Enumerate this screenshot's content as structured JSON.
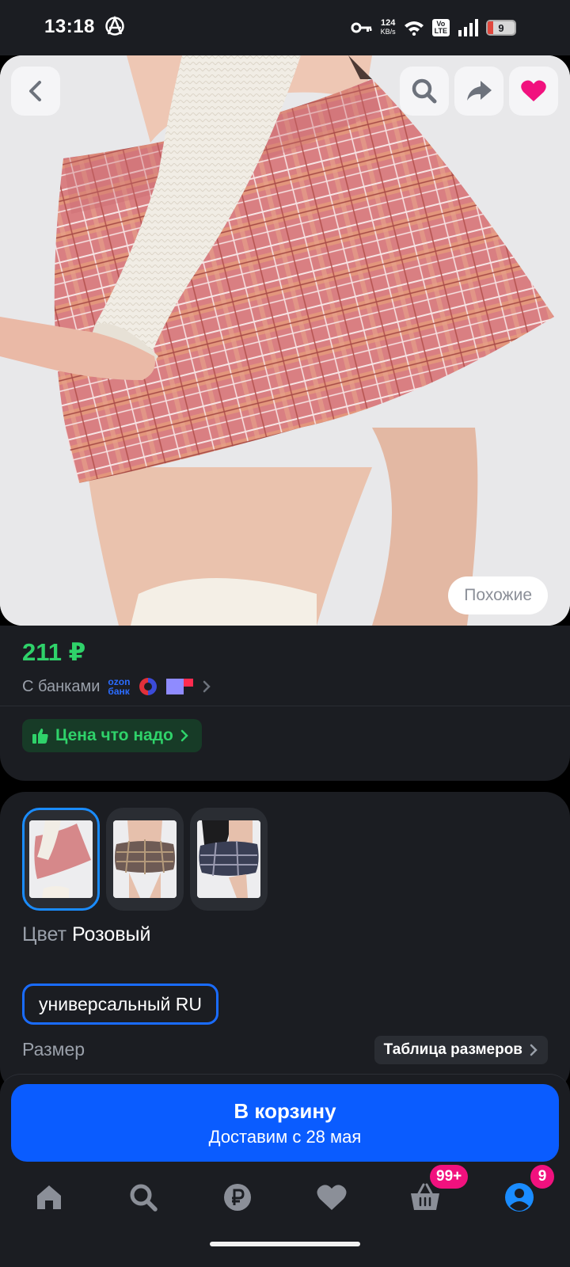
{
  "status_bar": {
    "time": "13:18",
    "net_speed_value": "124",
    "net_speed_unit": "KB/s",
    "volte_top": "Vo",
    "volte_bottom": "LTE",
    "battery": "9"
  },
  "hero": {
    "similar_label": "Похожие",
    "icons": [
      "back-icon",
      "search-icon",
      "share-icon",
      "heart-icon"
    ]
  },
  "price_card": {
    "price": "211 ₽",
    "banks_label": "С банками",
    "ozon_line1": "ozon",
    "ozon_line2": "банк",
    "promo_label": "Цена что надо"
  },
  "variants": {
    "thumbnails": [
      {
        "name": "pink",
        "selected": true
      },
      {
        "name": "brown-plaid",
        "selected": false
      },
      {
        "name": "navy-plaid",
        "selected": false
      }
    ],
    "color_label": "Цвет",
    "color_value": "Розовый",
    "size_chip": "универсальный RU",
    "size_label": "Размер",
    "size_table_label": "Таблица размеров"
  },
  "cart": {
    "title": "В корзину",
    "subtitle": "Доставим с 28 мая"
  },
  "nav": {
    "items": [
      "home-icon",
      "search-icon",
      "ruble-icon",
      "heart-icon",
      "basket-icon",
      "profile-icon"
    ],
    "basket_badge": "99+",
    "profile_badge": "9"
  },
  "colors": {
    "accent_blue": "#0a5cff",
    "price_green": "#2fd26a",
    "badge_pink": "#f1117e",
    "card_bg": "#1b1d22"
  }
}
